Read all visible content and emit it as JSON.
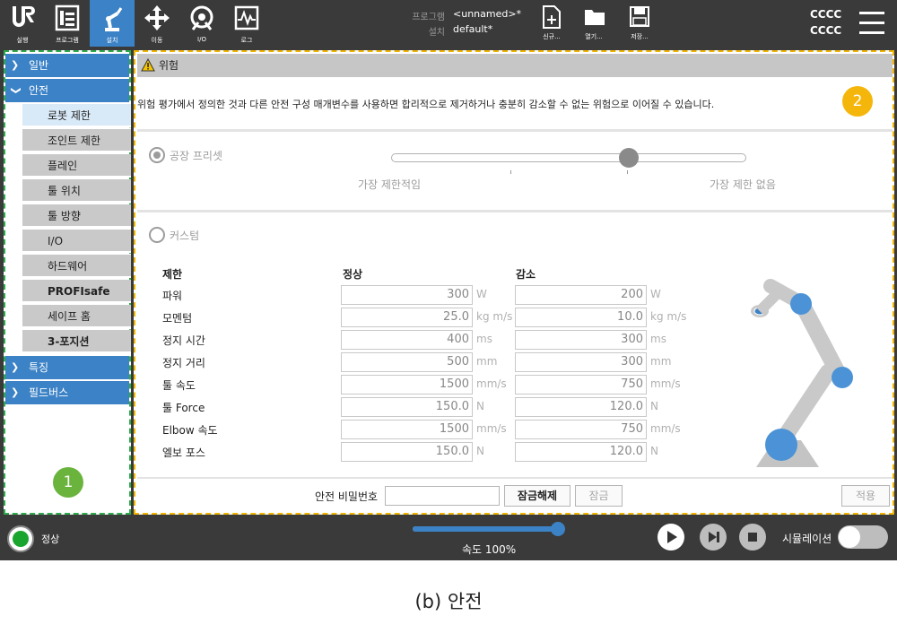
{
  "header": {
    "nav": [
      {
        "label": "실행",
        "icon": "ur-logo-icon"
      },
      {
        "label": "프로그램",
        "icon": "program-icon"
      },
      {
        "label": "설치",
        "icon": "robot-arm-icon"
      },
      {
        "label": "이동",
        "icon": "move-arrows-icon"
      },
      {
        "label": "I/O",
        "icon": "io-icon"
      },
      {
        "label": "로그",
        "icon": "log-icon"
      }
    ],
    "program_key": "프로그램",
    "program_value": "<unnamed>*",
    "install_key": "설치",
    "install_value": "default*",
    "file_buttons": [
      {
        "label": "신규...",
        "icon": "new-file-icon"
      },
      {
        "label": "열기...",
        "icon": "open-folder-icon"
      },
      {
        "label": "저장...",
        "icon": "save-icon"
      }
    ],
    "robot_id_top": "CCCC",
    "robot_id_bottom": "CCCC"
  },
  "sidebar": {
    "sections": [
      {
        "label": "일반",
        "expanded": false
      },
      {
        "label": "안전",
        "expanded": true
      },
      {
        "label": "특징",
        "expanded": false
      },
      {
        "label": "필드버스",
        "expanded": false
      }
    ],
    "safety_items": [
      "로봇 제한",
      "조인트 제한",
      "플레인",
      "툴 위치",
      "툴 방향",
      "I/O",
      "하드웨어",
      "PROFIsafe",
      "세이프 홈",
      "3-포지션"
    ],
    "selected": "로봇 제한",
    "badge": "1"
  },
  "main": {
    "title": "위험",
    "description": "위험 평가에서 정의한 것과 다른 안전 구성 매개변수를 사용하면 합리적으로 제거하거나 충분히 감소할 수 없는 위험으로 이어질 수 있습니다.",
    "badge": "2",
    "factory_preset_label": "공장 프리셋",
    "slider_min_label": "가장 제한적임",
    "slider_max_label": "가장 제한 없음",
    "slider_level": 0.67,
    "custom_label": "커스텀",
    "col_limit": "제한",
    "col_normal": "정상",
    "col_reduced": "감소",
    "rows": [
      {
        "label": "파워",
        "normal": "300",
        "reduced": "200",
        "unit": "W"
      },
      {
        "label": "모멘텀",
        "normal": "25.0",
        "reduced": "10.0",
        "unit": "kg m/s"
      },
      {
        "label": "정지 시간",
        "normal": "400",
        "reduced": "300",
        "unit": "ms"
      },
      {
        "label": "정지 거리",
        "normal": "500",
        "reduced": "300",
        "unit": "mm"
      },
      {
        "label": "툴 속도",
        "normal": "1500",
        "reduced": "750",
        "unit": "mm/s"
      },
      {
        "label": "툴 Force",
        "normal": "150.0",
        "reduced": "120.0",
        "unit": "N"
      },
      {
        "label": "Elbow 속도",
        "normal": "1500",
        "reduced": "750",
        "unit": "mm/s"
      },
      {
        "label": "엘보 포스",
        "normal": "150.0",
        "reduced": "120.0",
        "unit": "N"
      }
    ],
    "password_label": "안전 비밀번호",
    "unlock_label": "잠금해제",
    "lock_label": "잠금",
    "apply_label": "적용"
  },
  "footer": {
    "status": "정상",
    "speed_label": "속도 100%",
    "speed_level": 1.0,
    "simulation_label": "시뮬레이션"
  },
  "caption": "(b) 안전",
  "colors": {
    "accent": "#3c82c6",
    "sidebar_border": "#2eaa4c",
    "main_border": "#f0b400",
    "badge_green": "#6ab43e",
    "badge_yellow": "#f5b60c"
  }
}
